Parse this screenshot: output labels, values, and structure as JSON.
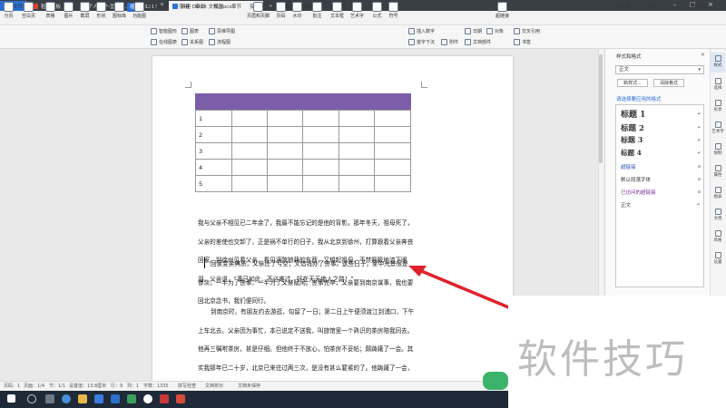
{
  "tabs": [
    {
      "label": "首页"
    },
    {
      "label": "稻壳模板"
    },
    {
      "label": "个人用户-重修文..+20191212"
    },
    {
      "label": "新建 DOCX 文档.docx"
    }
  ],
  "tab_new": "+",
  "window": {
    "minimize": "–",
    "maximize": "□",
    "close": "×",
    "sync": "已同步",
    "share": "分享",
    "user": "前王翔"
  },
  "menu": {
    "file": "三 文件",
    "items": [
      "开始",
      "插入",
      "页面布局",
      "引用",
      "审阅",
      "视图",
      "章节",
      "安全",
      "开发工具",
      "特色功能"
    ],
    "active_index": 1,
    "search": "Q查找"
  },
  "ribbon": {
    "big": [
      "分页",
      "空白页",
      "表格",
      "图片",
      "截屏",
      "形状",
      "图标库",
      "功能图",
      "页眉和页脚",
      "页码",
      "水印",
      "批注",
      "文本框",
      "艺术字",
      "公式",
      "符号",
      "首字下沉",
      "附件",
      "文档部件",
      "对象",
      "交叉引用",
      "超链接"
    ],
    "small": [
      "智能图形",
      "图表",
      "思维导图",
      "在线图表",
      "关系图",
      "流程图",
      "插入数字",
      "日期",
      "书签"
    ]
  },
  "table": {
    "rows": [
      "1",
      "2",
      "3",
      "4",
      "5"
    ],
    "header_color": "#7b5ea7"
  },
  "document": {
    "paragraphs": [
      "我与父亲不相见已二年余了，我最不能忘记的是他的背影。那年冬天，祖母死了，父亲的差使也交卸了，正是祸不单行的日子，我从北京到徐州，打算跟着父亲奔丧回家。到徐州见着父亲，看见满院狼藉的东西，又想起祖母，不禁簌簌地流下眼泪。父亲说，“事已如此，不必难过，好在天无绝人之路！”",
      "回家变卖典质，父亲还了亏空；又借钱办了丧事。这些日子，家中光景很是惨淡，一半为了丧事，一半为了父亲赋闲。丧事完毕，父亲要到南京谋事，我也要回北京念书，我们便同行。",
      "到南京时，有朋友约去游逛，勾留了一日；第二日上午便须渡江到浦口，下午上车北去。父亲因为事忙，本已说定不送我，叫旅馆里一个熟识的茶房陪我同去。他再三嘱咐茶房，甚是仔细。但他终于不放心，怕茶房不妥帖；颇踌躇了一会。其实我那年已二十岁，北京已来往过两三次，是没有甚么要紧的了。他踌躇了一会，终于决定还是自己送我去。我两三回劝他不必去；他只说，“不要紧，"
    ]
  },
  "style_pane": {
    "title": "样式和格式",
    "current_style": "正文",
    "new_style_btn": "新样式...",
    "clear_format_btn": "清除格式",
    "apply_label": "请选择要应用的格式",
    "styles": [
      "标题 1",
      "标题 2",
      "标题 3",
      "标题 4",
      "超链接",
      "默认段落字体",
      "已访问的超链接",
      "正文"
    ]
  },
  "side_tools": [
    "样式",
    "选择",
    "形状",
    "艺术字",
    "限制",
    "属性",
    "图表",
    "文档",
    "风格",
    "设置"
  ],
  "status": {
    "page": "页码：1",
    "pages": "页面：1/4",
    "section": "节：1/1",
    "setting": "设置值：13.8厘米",
    "row": "行：9",
    "col": "列：1",
    "words": "字数：1335",
    "spell": "拼写检查",
    "doc_check": "文档校对",
    "autosave": "文档未保存"
  },
  "watermark": "软件技巧",
  "arrow_color": "#e0222a"
}
